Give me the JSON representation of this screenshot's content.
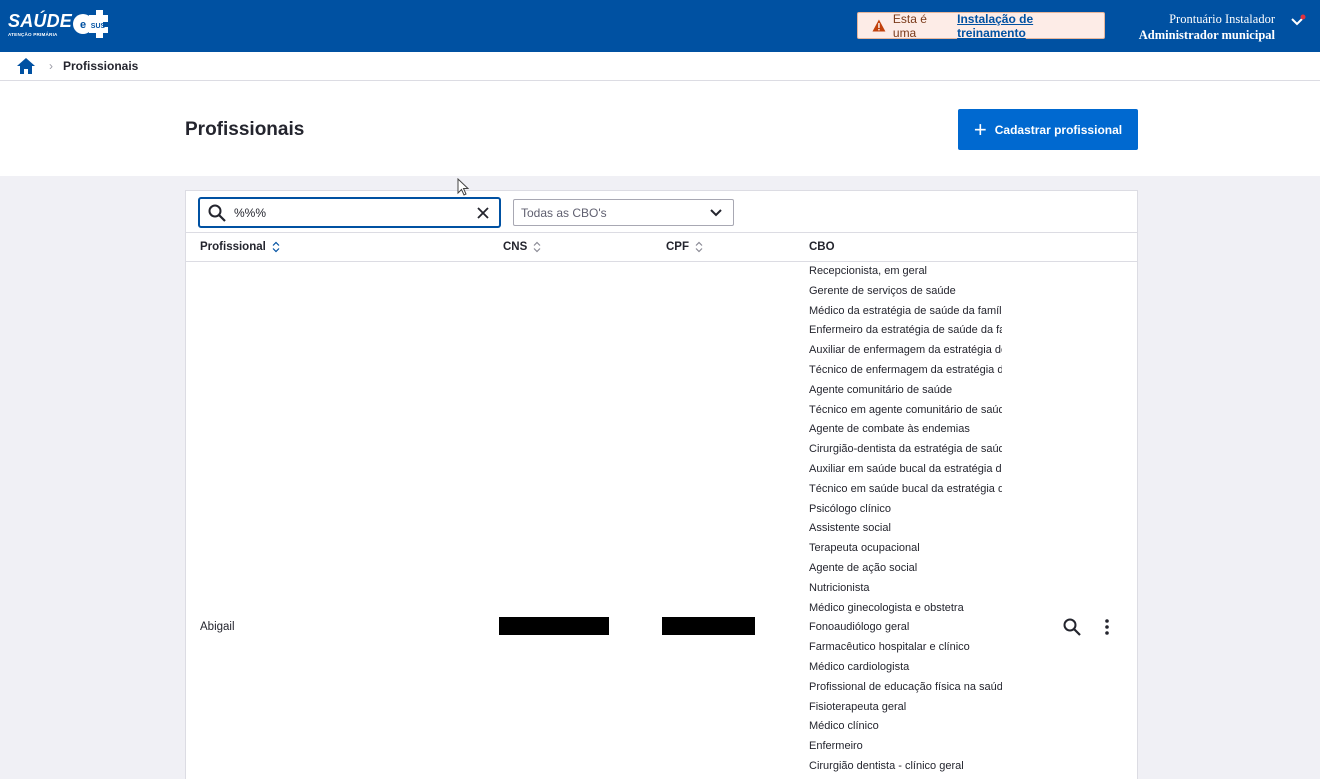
{
  "header": {
    "logo_text": "SAÚDE",
    "logo_sub": "ATENÇÃO PRIMÁRIA",
    "logo_badge": "SUS",
    "training_prefix": "Esta é uma",
    "training_link": "Instalação de treinamento",
    "user_name": "Prontuário Instalador",
    "user_role": "Administrador municipal"
  },
  "breadcrumb": {
    "current": "Profissionais"
  },
  "page": {
    "title": "Profissionais",
    "add_button": "Cadastrar profissional"
  },
  "filters": {
    "search_value": "%%%",
    "cbo_select": "Todas as CBO's"
  },
  "table": {
    "columns": [
      "Profissional",
      "CNS",
      "CPF",
      "CBO"
    ],
    "row": {
      "name": "Abigail",
      "cbos": [
        "Recepcionista, em geral",
        "Gerente de serviços de saúde",
        "Médico da estratégia de saúde da família",
        "Enfermeiro da estratégia de saúde da família",
        "Auxiliar de enfermagem da estratégia de saúde da família",
        "Técnico de enfermagem da estratégia de saúde da família",
        "Agente comunitário de saúde",
        "Técnico em agente comunitário de saúde",
        "Agente de combate às endemias",
        "Cirurgião-dentista da estratégia de saúde da família",
        "Auxiliar em saúde bucal da estratégia de saúde da família",
        "Técnico em saúde bucal da estratégia de saúde da família",
        "Psicólogo clínico",
        "Assistente social",
        "Terapeuta ocupacional",
        "Agente de ação social",
        "Nutricionista",
        "Médico ginecologista e obstetra",
        "Fonoaudiólogo geral",
        "Farmacêutico hospitalar e clínico",
        "Médico cardiologista",
        "Profissional de educação física na saúde",
        "Fisioterapeuta geral",
        "Médico clínico",
        "Enfermeiro",
        "Cirurgião dentista - clínico geral"
      ]
    }
  },
  "colors": {
    "header_bg": "#0051a2",
    "primary_button": "#0069d0",
    "page_bg": "#f0f0f5"
  }
}
